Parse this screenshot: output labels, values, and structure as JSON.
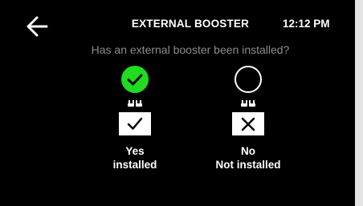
{
  "header": {
    "title": "EXTERNAL BOOSTER",
    "time": "12:12 PM",
    "back_icon": "arrow-left-icon"
  },
  "question": "Has an external booster been installed?",
  "options": [
    {
      "line1": "Yes",
      "line2": "installed",
      "selected": true,
      "icon": "checkmark-icon"
    },
    {
      "line1": "No",
      "line2": "Not installed",
      "selected": false,
      "icon": "x-mark-icon"
    }
  ],
  "colors": {
    "background": "#000000",
    "text": "#ffffff",
    "selected": "#1fdc1f",
    "muted": "#8c8c8c"
  }
}
